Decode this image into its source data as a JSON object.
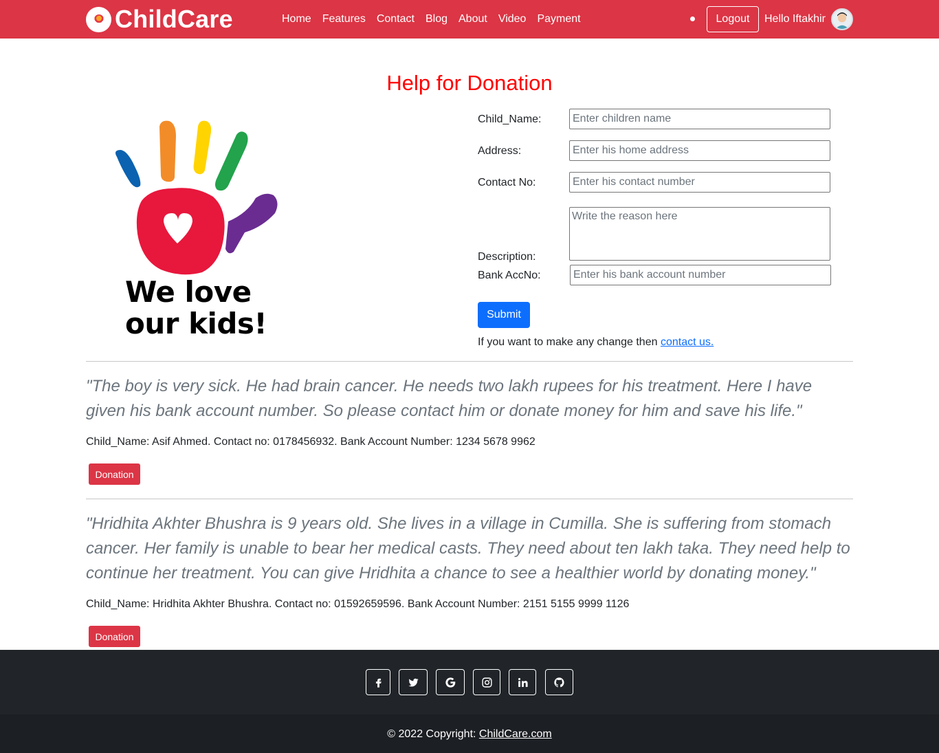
{
  "nav": {
    "brand": "ChildCare",
    "links": [
      "Home",
      "Features",
      "Contact",
      "Blog",
      "About",
      "Video",
      "Payment"
    ],
    "logout": "Logout",
    "greeting": "Hello Iftakhir"
  },
  "page_title": "Help for Donation",
  "image": {
    "caption_line1": "We love",
    "caption_line2": "our kids!"
  },
  "form": {
    "child_name": {
      "label": "Child_Name:",
      "placeholder": "Enter children name"
    },
    "address": {
      "label": "Address:",
      "placeholder": "Enter his home address"
    },
    "contact": {
      "label": "Contact No:",
      "placeholder": "Enter his contact number"
    },
    "description": {
      "label": "Description:",
      "placeholder": "Write the reason here"
    },
    "bank": {
      "label": "Bank AccNo:",
      "placeholder": "Enter his bank account number"
    },
    "submit": "Submit",
    "change_note": "If you want to make any change then ",
    "change_link": "contact us."
  },
  "requests": [
    {
      "quote": "\"The boy is very sick. He had brain cancer. He needs two lakh rupees for his treatment. Here I have given his bank account number. So please contact him or donate money for him and save his life.\"",
      "detail": "Child_Name: Asif Ahmed. Contact no: 0178456932. Bank Account Number: 1234 5678 9962",
      "button": "Donation"
    },
    {
      "quote": "\"Hridhita Akhter Bhushra is 9 years old. She lives in a village in Cumilla. She is suffering from stomach cancer. Her family is unable to bear her medical casts. They need about ten lakh taka. They need help to continue her treatment. You can give Hridhita a chance to see a healthier world by donating money.\"",
      "detail": "Child_Name: Hridhita Akhter Bhushra. Contact no: 01592659596. Bank Account Number: 2151 5155 9999 1126",
      "button": "Donation"
    }
  ],
  "footer": {
    "social_icons": [
      "facebook-icon",
      "twitter-icon",
      "google-icon",
      "instagram-icon",
      "linkedin-icon",
      "github-icon"
    ],
    "copyright_prefix": "© 2022 Copyright: ",
    "copyright_link": "ChildCare.com"
  },
  "colors": {
    "navbar": "#dc3545",
    "title": "#ff0000",
    "primary_button": "#0d6efd",
    "donation_button": "#dc3545",
    "footer": "#212529"
  }
}
